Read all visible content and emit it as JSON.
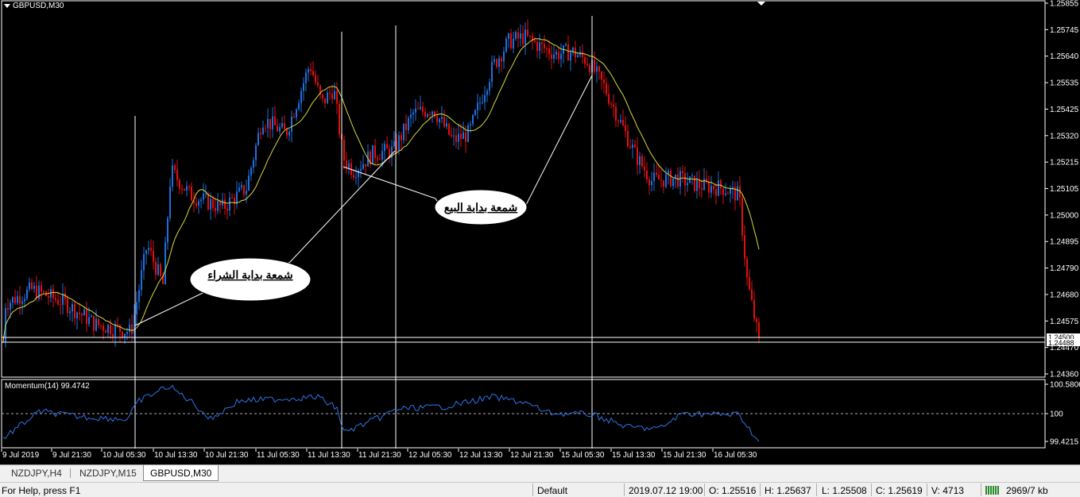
{
  "chart": {
    "title": "GBPUSD,M30",
    "indicator_label": "Momentum(14) 99.4742",
    "annotation_buy": "شمعة بداية الشراء",
    "annotation_sell": "شمعة بداية البيع",
    "bid_label": "1.24500",
    "ask_label": "1.24488",
    "price_ticks": [
      "1.25855",
      "1.25745",
      "1.25640",
      "1.25535",
      "1.25425",
      "1.25320",
      "1.25215",
      "1.25105",
      "1.25000",
      "1.24895",
      "1.24790",
      "1.24680",
      "1.24575",
      "1.24470",
      "1.24360"
    ],
    "momentum_ticks": [
      "100.5806",
      "100",
      "99.4215"
    ],
    "time_ticks": [
      "9 Jul 2019",
      "9 Jul 21:30",
      "10 Jul 05:30",
      "10 Jul 13:30",
      "10 Jul 21:30",
      "11 Jul 05:30",
      "11 Jul 13:30",
      "11 Jul 21:30",
      "12 Jul 05:30",
      "12 Jul 13:30",
      "12 Jul 21:30",
      "15 Jul 05:30",
      "15 Jul 13:30",
      "15 Jul 21:30",
      "16 Jul 05:30"
    ],
    "colors": {
      "background": "#000000",
      "bull": "#1e6fdc",
      "bear": "#e01010",
      "ma": "#d8d840",
      "momentum": "#2e74e8",
      "vlines": "#ffffff"
    }
  },
  "tabs": [
    {
      "label": "NZDJPY,H4",
      "active": false
    },
    {
      "label": "NZDJPY,M15",
      "active": false
    },
    {
      "label": "GBPUSD,M30",
      "active": true
    }
  ],
  "status": {
    "help": "For Help, press F1",
    "profile": "Default",
    "datetime": "2019.07.12 19:00",
    "open": "O: 1.25516",
    "high": "H: 1.25637",
    "low": "L: 1.25508",
    "close": "C: 1.25619",
    "volume": "V: 4713",
    "traffic": "2969/7 kb"
  }
}
